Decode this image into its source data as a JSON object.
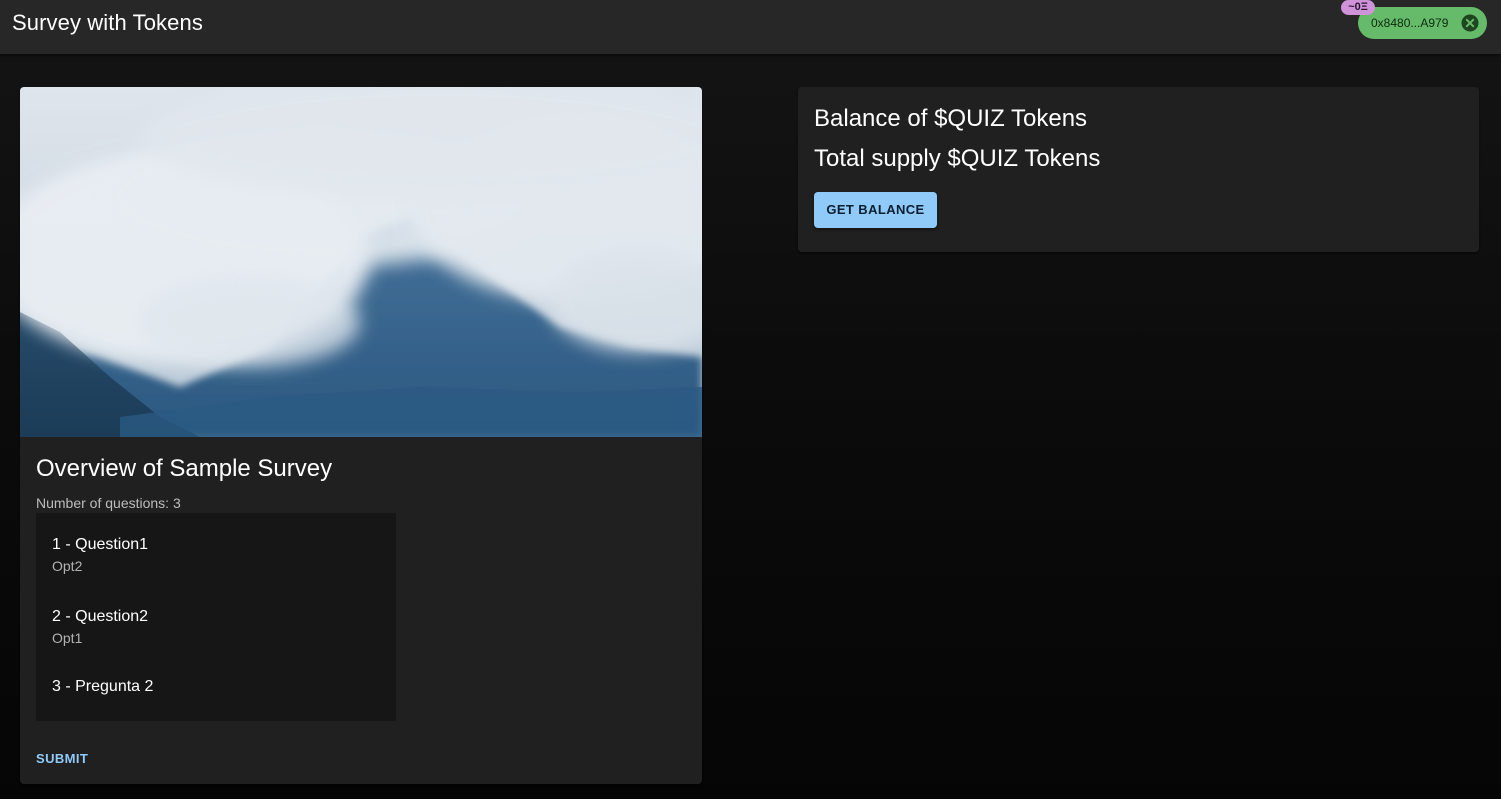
{
  "app": {
    "title": "Survey with Tokens"
  },
  "wallet": {
    "eth_balance": "~0Ξ",
    "address": "0x8480...A979",
    "chip_color": "#66bb6a",
    "badge_color": "#ce93d8"
  },
  "survey": {
    "image_icon": "misty-mountain-image",
    "title": "Overview of Sample Survey",
    "question_count": "Number of questions: 3",
    "questions": [
      {
        "label": "1 - Question1",
        "answer": "Opt2"
      },
      {
        "label": "2 - Question2",
        "answer": "Opt1"
      },
      {
        "label": "3 - Pregunta 2",
        "answer": ""
      }
    ],
    "submit_label": "SUBMIT"
  },
  "balance": {
    "balance_title": "Balance of $QUIZ Tokens",
    "supply_title": "Total supply $QUIZ Tokens",
    "button_label": "GET BALANCE",
    "accent_color": "#90caf9"
  }
}
